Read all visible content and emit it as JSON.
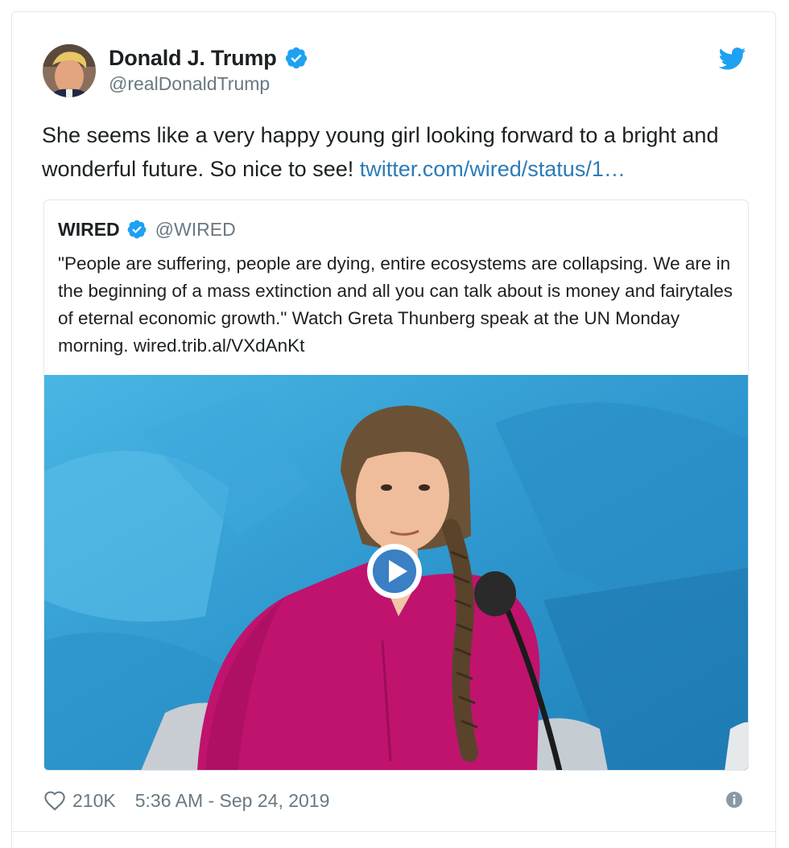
{
  "author": {
    "name": "Donald J. Trump",
    "handle": "@realDonaldTrump",
    "verified": true,
    "avatar_icon": "profile-photo"
  },
  "tweet": {
    "text": "She seems like a very happy young girl looking forward to a bright and wonderful future. So nice to see! ",
    "link": "twitter.com/wired/status/1…"
  },
  "quoted_tweet": {
    "name": "WIRED",
    "handle": "@WIRED",
    "verified": true,
    "text": "\"People are suffering, people are dying, entire ecosystems are collapsing. We are in the beginning of a mass extinction and all you can talk about is money and fairytales of eternal economic growth.\" Watch Greta Thunberg speak at the UN Monday morning. wired.trib.al/VXdAnKt",
    "media": {
      "type": "video",
      "play_icon": "play-icon"
    }
  },
  "footer": {
    "likes": "210K",
    "timestamp": "5:36 AM - Sep 24, 2019",
    "heart_icon": "heart-icon",
    "info_icon": "info-icon"
  },
  "colors": {
    "link": "#2b7bb9",
    "verified": "#1da1f2",
    "secondary_text": "#697882",
    "border": "#e1e8ed",
    "shirt": "#c0136e"
  }
}
